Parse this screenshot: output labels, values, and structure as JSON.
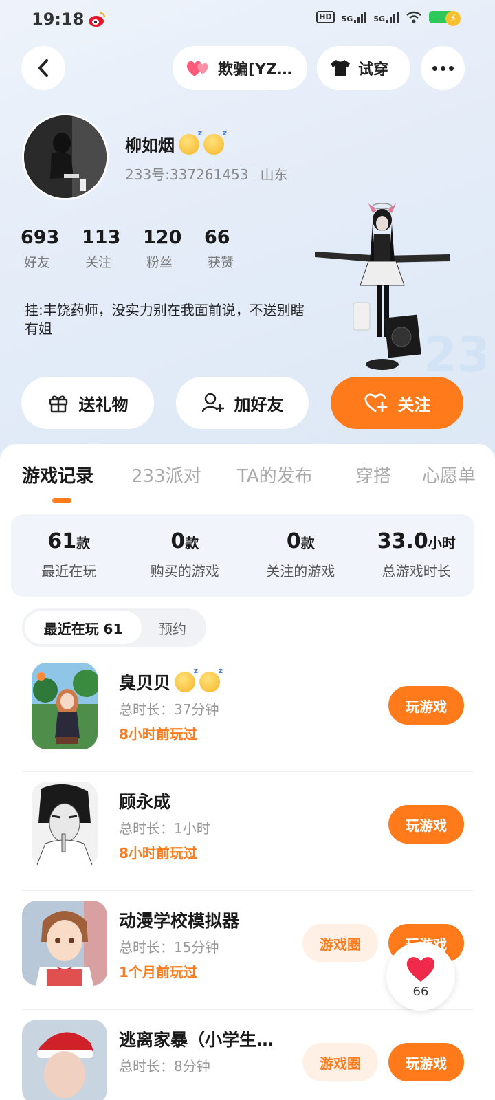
{
  "status_bar": {
    "time": "19:18",
    "hd_label": "HD",
    "net1": "5G",
    "net2": "5G"
  },
  "nav": {
    "relation_label": "欺骗[YZ…",
    "tryon_label": "试穿"
  },
  "profile": {
    "nickname": "柳如烟",
    "id_text": "233号:337261453",
    "region": "山东",
    "stats": [
      {
        "value": "693",
        "label": "好友"
      },
      {
        "value": "113",
        "label": "关注"
      },
      {
        "value": "120",
        "label": "粉丝"
      },
      {
        "value": "66",
        "label": "获赞"
      }
    ],
    "bio": "挂:丰饶药师，没实力别在我面前说，不送别瞎有姐"
  },
  "actions": {
    "gift": "送礼物",
    "add_friend": "加好友",
    "follow": "关注"
  },
  "tabs": [
    "游戏记录",
    "233派对",
    "TA的发布",
    "穿搭",
    "心愿单"
  ],
  "summary": [
    {
      "value": "61",
      "unit": "款",
      "label": "最近在玩"
    },
    {
      "value": "0",
      "unit": "款",
      "label": "购买的游戏"
    },
    {
      "value": "0",
      "unit": "款",
      "label": "关注的游戏"
    },
    {
      "value": "33.0",
      "unit": "小时",
      "label": "总游戏时长"
    }
  ],
  "subtabs": {
    "recent": "最近在玩 61",
    "reserve": "预约"
  },
  "games": [
    {
      "name": "臭贝贝",
      "duration": "总时长：37分钟",
      "last_played": "8小时前玩过",
      "play": "玩游戏"
    },
    {
      "name": "顾永成",
      "duration": "总时长：1小时",
      "last_played": "8小时前玩过",
      "play": "玩游戏"
    },
    {
      "name": "动漫学校模拟器",
      "duration": "总时长：15分钟",
      "last_played": "1个月前玩过",
      "circle": "游戏圈",
      "play": "玩游戏"
    },
    {
      "name": "逃离家暴（小学生…",
      "duration": "总时长：8分钟",
      "circle": "游戏圈",
      "play": "玩游戏"
    }
  ],
  "like_float": {
    "count": "66"
  },
  "colors": {
    "accent": "#ff7a1a",
    "summary_bg": "#f1f5fb"
  }
}
